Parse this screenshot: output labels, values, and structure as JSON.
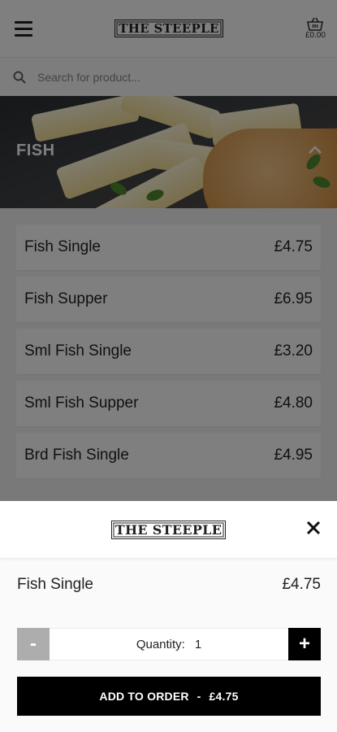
{
  "header": {
    "logo_text": "THE STEEPLE",
    "basket_total": "£0.00"
  },
  "search": {
    "placeholder": "Search for product..."
  },
  "category": {
    "title": "FISH"
  },
  "products": [
    {
      "name": "Fish Single",
      "price": "£4.75"
    },
    {
      "name": "Fish Supper",
      "price": "£6.95"
    },
    {
      "name": "Sml Fish Single",
      "price": "£3.20"
    },
    {
      "name": "Sml Fish Supper",
      "price": "£4.80"
    },
    {
      "name": "Brd Fish Single",
      "price": "£4.95"
    }
  ],
  "sheet": {
    "logo_text": "THE STEEPLE",
    "product_name": "Fish Single",
    "product_price": "£4.75",
    "quantity_label": "Quantity:",
    "quantity_value": "1",
    "minus_label": "-",
    "plus_label": "+",
    "add_label": "ADD TO ORDER",
    "add_separator": "-",
    "add_price": "£4.75"
  }
}
